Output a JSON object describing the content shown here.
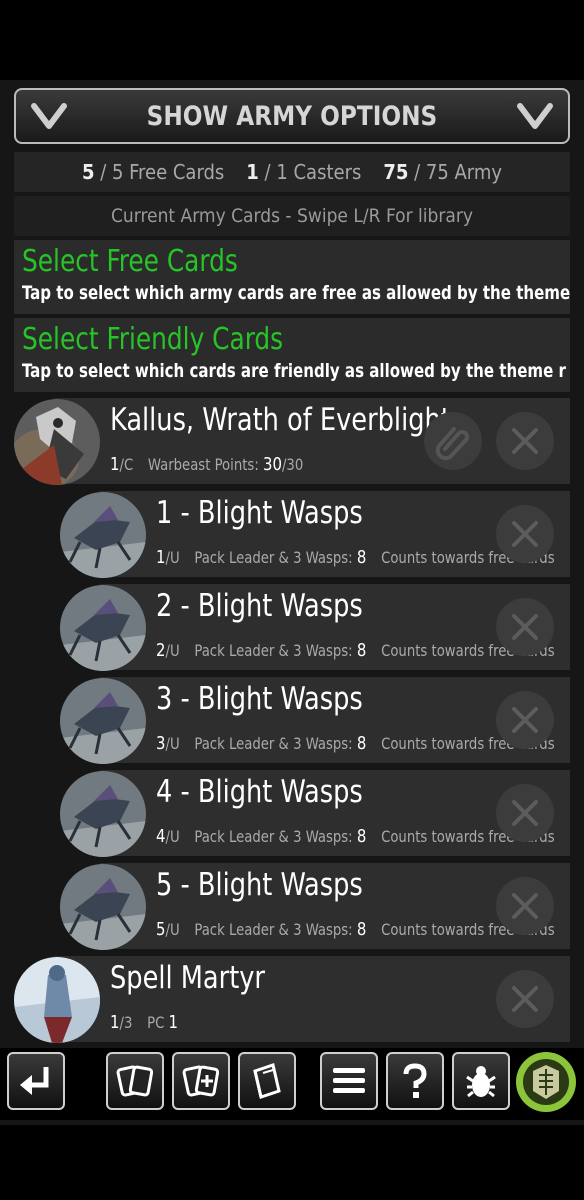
{
  "header": {
    "label": "SHOW ARMY OPTIONS",
    "left_icon": "chevron-down-icon",
    "right_icon": "chevron-down-icon"
  },
  "stats": {
    "free_current": "5",
    "free_rest": " / 5 Free Cards",
    "casters_current": "1",
    "casters_rest": " / 1 Casters",
    "army_current": "75",
    "army_rest": " / 75 Army"
  },
  "subheader": "Current Army Cards - Swipe L/R For library",
  "select_free": {
    "title": "Select Free Cards",
    "desc": "Tap to select which army cards are free as allowed by the theme"
  },
  "select_friendly": {
    "title": "Select Friendly Cards",
    "desc": "Tap to select which cards are friendly as allowed by the theme r"
  },
  "cards": [
    {
      "title": "Kallus, Wrath of Everblight",
      "count": "1",
      "count_rest": "/C",
      "meta_label": "Warbeast Points:",
      "meta_value": "30",
      "meta_rest": "/30",
      "note": ""
    },
    {
      "title": "1 - Blight Wasps",
      "count": "1",
      "count_rest": "/U",
      "meta_label": "Pack Leader & 3 Wasps:",
      "meta_value": "8",
      "meta_rest": "",
      "note": "Counts towards free cards"
    },
    {
      "title": "2 - Blight Wasps",
      "count": "2",
      "count_rest": "/U",
      "meta_label": "Pack Leader & 3 Wasps:",
      "meta_value": "8",
      "meta_rest": "",
      "note": "Counts towards free cards"
    },
    {
      "title": "3 - Blight Wasps",
      "count": "3",
      "count_rest": "/U",
      "meta_label": "Pack Leader & 3 Wasps:",
      "meta_value": "8",
      "meta_rest": "",
      "note": "Counts towards free cards"
    },
    {
      "title": "4 - Blight Wasps",
      "count": "4",
      "count_rest": "/U",
      "meta_label": "Pack Leader & 3 Wasps:",
      "meta_value": "8",
      "meta_rest": "",
      "note": "Counts towards free cards"
    },
    {
      "title": "5 - Blight Wasps",
      "count": "5",
      "count_rest": "/U",
      "meta_label": "Pack Leader & 3 Wasps:",
      "meta_value": "8",
      "meta_rest": "",
      "note": "Counts towards free cards"
    },
    {
      "title": "Spell Martyr",
      "count": "1",
      "count_rest": "/3",
      "meta_label": "PC",
      "meta_value": "1",
      "meta_rest": "",
      "note": ""
    }
  ],
  "icons": {
    "remove": "close-icon",
    "attach": "paperclip-icon",
    "toolbar": [
      "back-arrow-icon",
      "cards-icon",
      "add-card-icon",
      "book-icon",
      "menu-icon",
      "help-icon",
      "bug-icon",
      "faction-logo-icon"
    ]
  },
  "colors": {
    "accent_green": "#27c427",
    "background": "#161616",
    "row": "#2e2e2e"
  }
}
